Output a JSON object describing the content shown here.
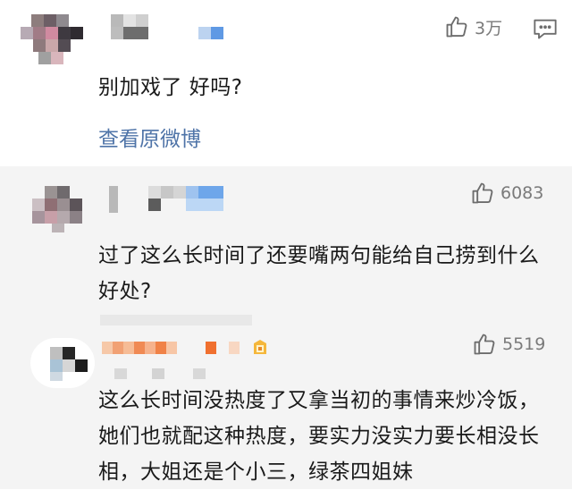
{
  "comments": [
    {
      "likes": "3万",
      "text": "别加戏了 好吗?",
      "view_original": "查看原微博"
    },
    {
      "likes": "6083",
      "text": "过了这么长时间了还要嘴两句能给自己捞到什么好处?"
    },
    {
      "likes": "5519",
      "text": "这么长时间没热度了又拿当初的事情来炒冷饭，她们也就配这种热度，要实力没实力要长相没长相，大姐还是个小三，绿茶四姐妹"
    }
  ],
  "icons": {
    "like": "thumbs-up-icon",
    "reply": "comment-bubble-icon",
    "badge": "member-badge-icon"
  },
  "colors": {
    "link": "#4f74a8",
    "likes_text": "#7a7a7a",
    "reply_bg": "#f4f4f4"
  }
}
